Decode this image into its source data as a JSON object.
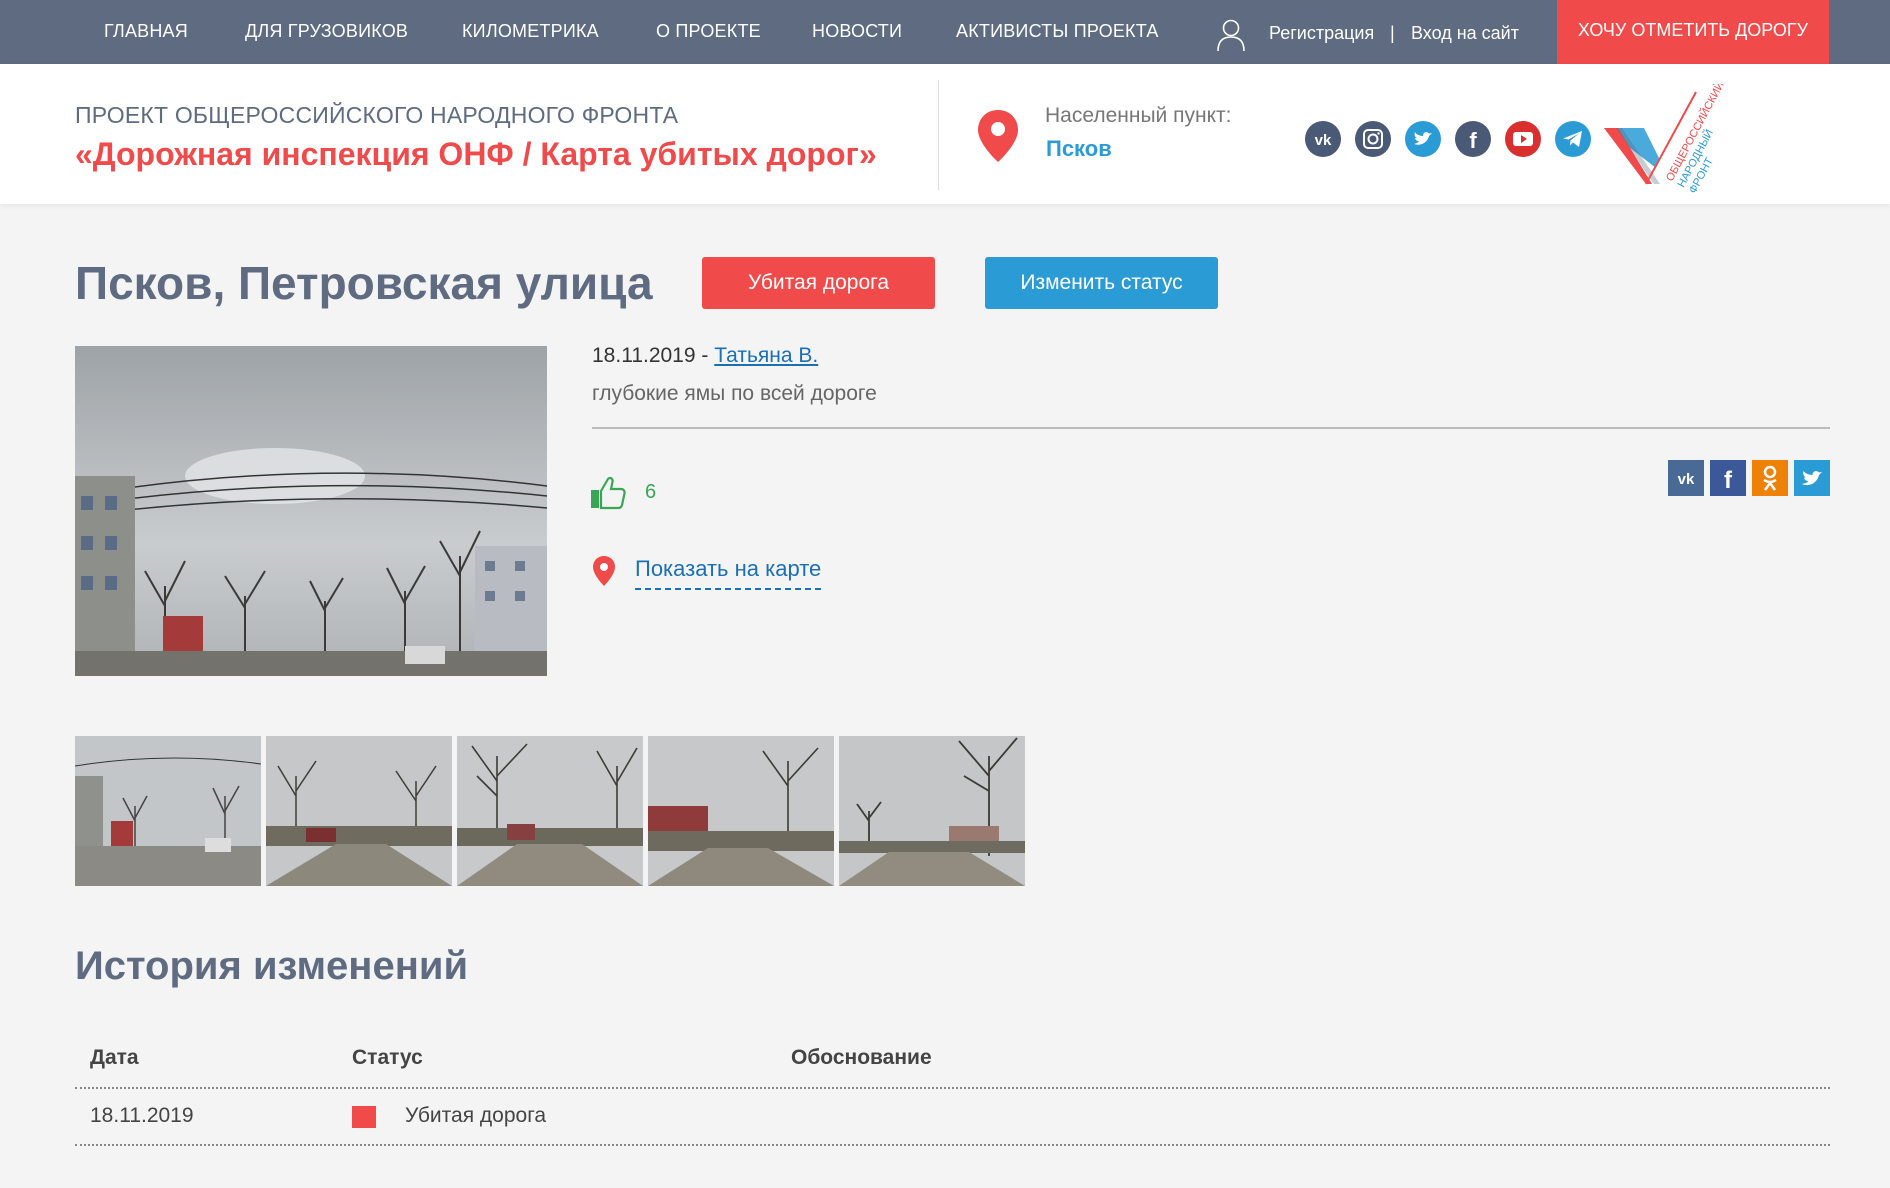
{
  "nav": {
    "items": [
      "Главная",
      "Для грузовиков",
      "Километрика",
      "О проекте",
      "Новости",
      "Активисты проекта"
    ],
    "register": "Регистрация",
    "separator": "|",
    "login": "Вход на сайт",
    "cta": "Хочу отметить дорогу"
  },
  "header": {
    "subtitle": "Проект Общероссийского народного фронта",
    "title": "«Дорожная инспекция ОНФ / Карта убитых дорог»",
    "location_label": "Населенный пункт:",
    "location_value": "Псков",
    "socials": [
      "vk-icon",
      "instagram-icon",
      "twitter-icon",
      "facebook-icon",
      "youtube-icon",
      "telegram-icon"
    ],
    "logo_text": [
      "ОБЩЕРОССИЙСКИЙ",
      "НАРОДНЫЙ",
      "ФРОНТ"
    ]
  },
  "page": {
    "title": "Псков, Петровская улица",
    "status_button": "Убитая дорога",
    "change_status_button": "Изменить статус"
  },
  "report": {
    "date": "18.11.2019",
    "date_sep": " - ",
    "author": "Татьяна В.",
    "description": "глубокие ямы по всей дороге",
    "likes": "6",
    "map_link": "Показать на карте",
    "share": [
      "vk-icon",
      "facebook-icon",
      "odnoklassniki-icon",
      "twitter-icon"
    ]
  },
  "history": {
    "title": "История изменений",
    "columns": [
      "Дата",
      "Статус",
      "Обоснование"
    ],
    "rows": [
      {
        "date": "18.11.2019",
        "status": "Убитая дорога",
        "reason": ""
      }
    ]
  },
  "colors": {
    "nav_bg": "#5e6b80",
    "accent_red": "#f04a4a",
    "accent_blue": "#2b9bd6",
    "link": "#1a6fb5"
  }
}
